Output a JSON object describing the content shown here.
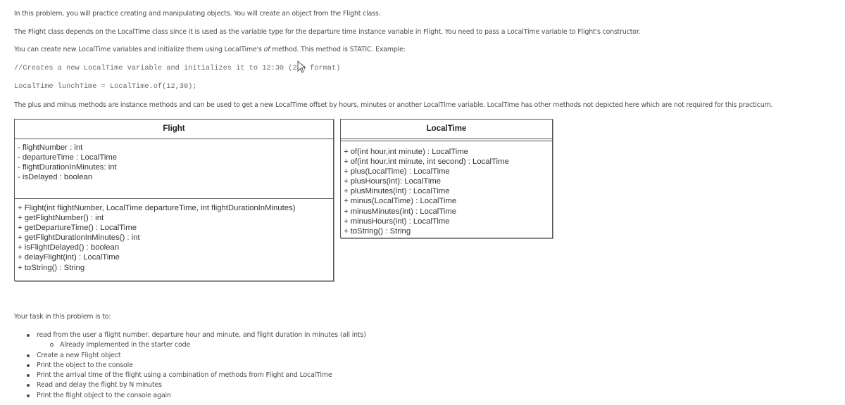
{
  "intro": {
    "p1": "In this problem, you will practice creating and manipulating objects. You will create an object from the Flight class.",
    "p2": "The Flight class depends on the LocalTime class since it is used as the variable type for the departure time instance variable in Flight. You need to pass a LocalTime variable to Flight's constructor.",
    "p3_before": "You can create new LocalTime variables and initialize them using LocalTime's ",
    "p3_italic": "of",
    "p3_after": " method. This method is STATIC. Example:",
    "code_comment": "//Creates a new LocalTime variable and initializes it to 12:30 (24h format)",
    "code_line": "LocalTime lunchTime = LocalTime.of(12,30);",
    "p4": "The plus and minus methods are instance methods and can be used to get a new LocalTime offset by hours, minutes or another LocalTime variable. LocalTime has other methods not depicted here which are not required for this practicum."
  },
  "flight_class": {
    "name": "Flight",
    "attributes": [
      "- flightNumber : int",
      "- departureTime : LocalTime",
      "- flightDurationInMinutes: int",
      "- isDelayed : boolean"
    ],
    "methods": [
      "+ Flight(int flightNumber, LocalTime departureTime, int flightDurationInMinutes)",
      "+ getFlightNumber() : int",
      "+ getDepartureTime() : LocalTime",
      "+ getFlightDurationInMinutes() : int",
      "+ isFlightDelayed() : boolean",
      "+ delayFlight(int) : LocalTime",
      "+ toString() : String"
    ]
  },
  "localtime_class": {
    "name": "LocalTime",
    "attributes": [],
    "methods": [
      "+ of(int hour,int minute) : LocalTime",
      "+ of(int hour,int minute, int second) : LocalTime",
      "+ plus(LocalTime) : LocalTime",
      "+ plusHours(int): LocalTime",
      "+ plusMinutes(int) : LocalTime",
      "+ minus(LocalTime) : LocalTime",
      "+ minusMinutes(int) : LocalTime",
      "+ minusHours(int) : LocalTime",
      "+ toString() : String"
    ]
  },
  "task": {
    "heading": "Your task in this problem is to:",
    "items": [
      {
        "text": "read from the user a flight number, departure hour and minute, and flight duration in minutes (all ints)",
        "level": 1
      },
      {
        "text": "Already implemented in the starter code",
        "level": 2
      },
      {
        "text": "Create a new Flight object",
        "level": 1
      },
      {
        "text": "Print the object to the console",
        "level": 1
      },
      {
        "text": "Print the arrival time of the flight using a combination of methods from Flight and LocalTime",
        "level": 1
      },
      {
        "text": "Read and delay the flight by N minutes",
        "level": 1
      },
      {
        "text": "Print the flight object to the console again",
        "level": 1
      }
    ]
  },
  "cursor": {
    "icon": "mouse-pointer-icon"
  }
}
